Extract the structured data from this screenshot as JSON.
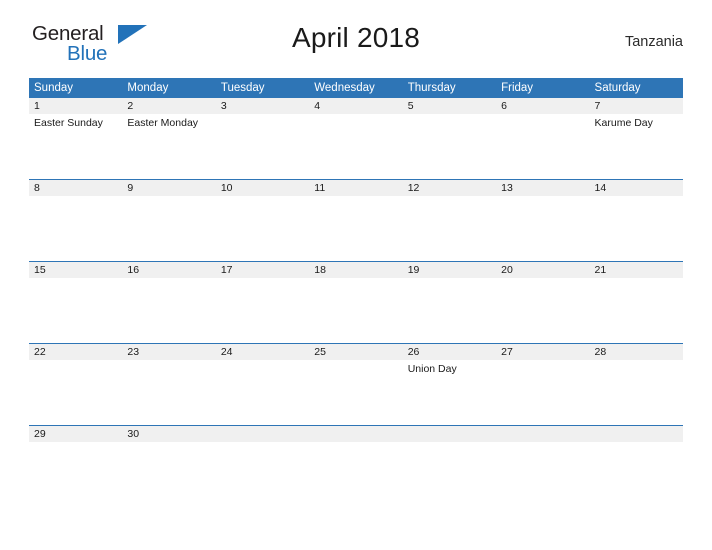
{
  "brand": {
    "name_part1": "General",
    "name_part2": "Blue",
    "flag_icon": "blue-triangle-flag-icon",
    "color_dark": "#231f20",
    "color_blue": "#2272b9"
  },
  "header": {
    "title": "April 2018",
    "region": "Tanzania"
  },
  "calendar": {
    "header_bg": "#2e75b6",
    "daynum_bg": "#f0f0f0",
    "weekdays": [
      "Sunday",
      "Monday",
      "Tuesday",
      "Wednesday",
      "Thursday",
      "Friday",
      "Saturday"
    ],
    "weeks": [
      [
        {
          "day": "1",
          "events": [
            "Easter Sunday"
          ]
        },
        {
          "day": "2",
          "events": [
            "Easter Monday"
          ]
        },
        {
          "day": "3",
          "events": []
        },
        {
          "day": "4",
          "events": []
        },
        {
          "day": "5",
          "events": []
        },
        {
          "day": "6",
          "events": []
        },
        {
          "day": "7",
          "events": [
            "Karume Day"
          ]
        }
      ],
      [
        {
          "day": "8",
          "events": []
        },
        {
          "day": "9",
          "events": []
        },
        {
          "day": "10",
          "events": []
        },
        {
          "day": "11",
          "events": []
        },
        {
          "day": "12",
          "events": []
        },
        {
          "day": "13",
          "events": []
        },
        {
          "day": "14",
          "events": []
        }
      ],
      [
        {
          "day": "15",
          "events": []
        },
        {
          "day": "16",
          "events": []
        },
        {
          "day": "17",
          "events": []
        },
        {
          "day": "18",
          "events": []
        },
        {
          "day": "19",
          "events": []
        },
        {
          "day": "20",
          "events": []
        },
        {
          "day": "21",
          "events": []
        }
      ],
      [
        {
          "day": "22",
          "events": []
        },
        {
          "day": "23",
          "events": []
        },
        {
          "day": "24",
          "events": []
        },
        {
          "day": "25",
          "events": []
        },
        {
          "day": "26",
          "events": [
            "Union Day"
          ]
        },
        {
          "day": "27",
          "events": []
        },
        {
          "day": "28",
          "events": []
        }
      ],
      [
        {
          "day": "29",
          "events": []
        },
        {
          "day": "30",
          "events": []
        },
        {
          "day": "",
          "events": []
        },
        {
          "day": "",
          "events": []
        },
        {
          "day": "",
          "events": []
        },
        {
          "day": "",
          "events": []
        },
        {
          "day": "",
          "events": []
        }
      ]
    ]
  }
}
